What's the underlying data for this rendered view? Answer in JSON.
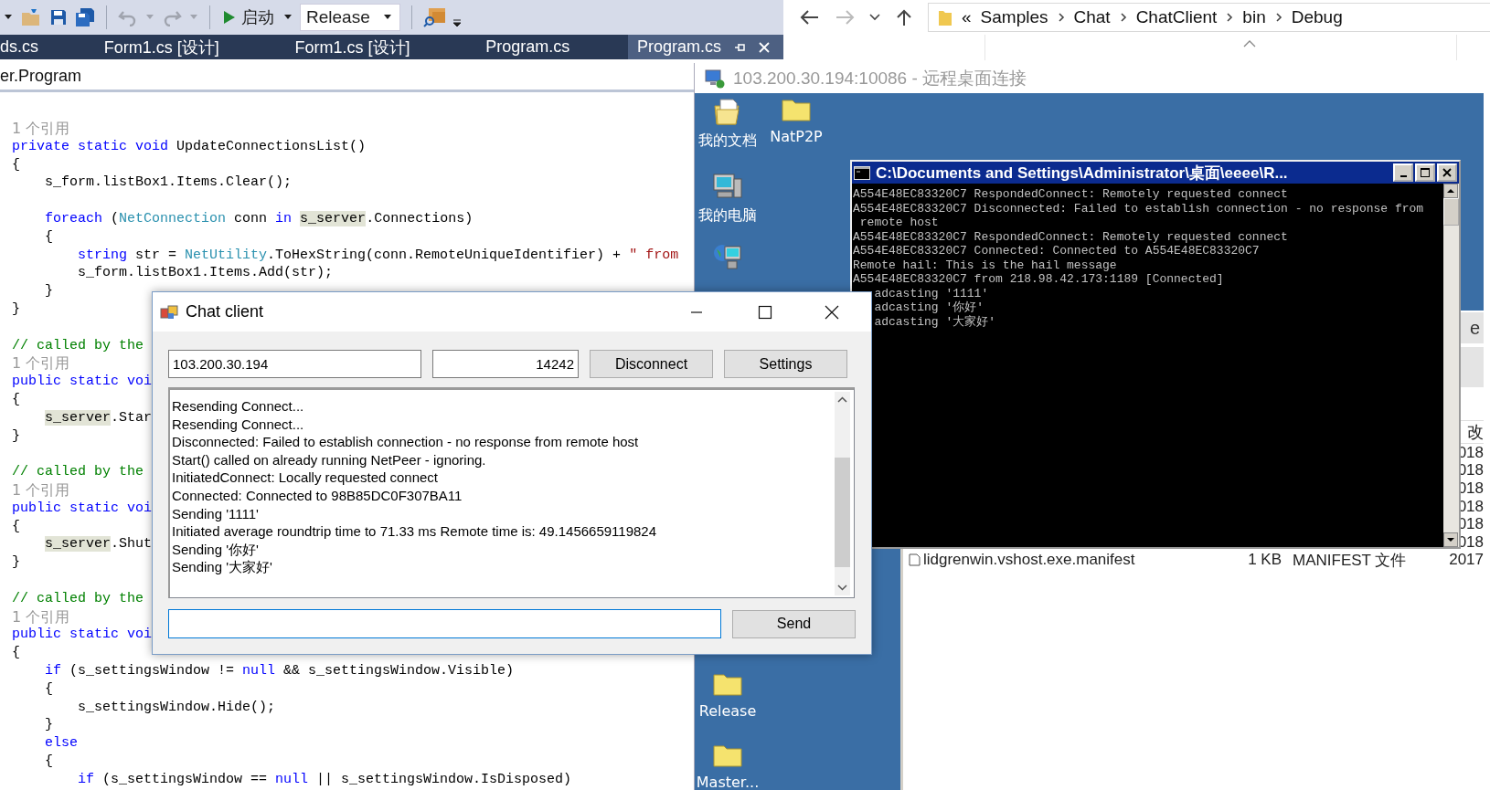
{
  "ide": {
    "toolbar": {
      "run_label": "启动",
      "configuration": "Release"
    },
    "tabs": [
      {
        "label": "ds.cs",
        "selected": false
      },
      {
        "label": "Form1.cs [设计]",
        "selected": false
      },
      {
        "label": "Form1.cs [设计]",
        "selected": false
      },
      {
        "label": "Program.cs",
        "selected": false
      },
      {
        "label": "Program.cs",
        "selected": true
      }
    ],
    "nav": "er.Program",
    "code": [
      {
        "kind": "ref",
        "text": "1 个引用"
      },
      {
        "kind": "code",
        "tokens": [
          {
            "kind": "kw",
            "t": "private static void "
          },
          {
            "kind": "plain",
            "t": "UpdateConnectionsList()"
          }
        ]
      },
      {
        "kind": "code",
        "tokens": [
          {
            "kind": "plain",
            "t": "{"
          }
        ]
      },
      {
        "kind": "code",
        "tokens": [
          {
            "kind": "plain",
            "t": "    s_form.listBox1.Items.Clear();"
          }
        ]
      },
      {
        "kind": "blank"
      },
      {
        "kind": "code",
        "tokens": [
          {
            "kind": "kw",
            "t": "    foreach "
          },
          {
            "kind": "plain",
            "t": "("
          },
          {
            "kind": "type",
            "t": "NetConnection"
          },
          {
            "kind": "plain",
            "t": " conn "
          },
          {
            "kind": "kw",
            "t": "in "
          },
          {
            "kind": "hl",
            "t": "s_server"
          },
          {
            "kind": "plain",
            "t": ".Connections)"
          }
        ]
      },
      {
        "kind": "code",
        "tokens": [
          {
            "kind": "plain",
            "t": "    {"
          }
        ]
      },
      {
        "kind": "code",
        "tokens": [
          {
            "kind": "kw",
            "t": "        string "
          },
          {
            "kind": "plain",
            "t": "str = "
          },
          {
            "kind": "type",
            "t": "NetUtility"
          },
          {
            "kind": "plain",
            "t": ".ToHexString(conn.RemoteUniqueIdentifier) + "
          },
          {
            "kind": "str",
            "t": "\" from"
          }
        ]
      },
      {
        "kind": "code",
        "tokens": [
          {
            "kind": "plain",
            "t": "        s_form.listBox1.Items.Add(str);"
          }
        ]
      },
      {
        "kind": "code",
        "tokens": [
          {
            "kind": "plain",
            "t": "    }"
          }
        ]
      },
      {
        "kind": "code",
        "tokens": [
          {
            "kind": "plain",
            "t": "}"
          }
        ]
      },
      {
        "kind": "blank"
      },
      {
        "kind": "code",
        "tokens": [
          {
            "kind": "comment",
            "t": "// called by the"
          }
        ]
      },
      {
        "kind": "ref",
        "text": "1 个引用"
      },
      {
        "kind": "code",
        "tokens": [
          {
            "kind": "kw",
            "t": "public static voi"
          }
        ]
      },
      {
        "kind": "code",
        "tokens": [
          {
            "kind": "plain",
            "t": "{"
          }
        ]
      },
      {
        "kind": "code",
        "tokens": [
          {
            "kind": "hl",
            "t": "    s_server"
          },
          {
            "kind": "plain",
            "t": ".Star"
          }
        ]
      },
      {
        "kind": "code",
        "tokens": [
          {
            "kind": "plain",
            "t": "}"
          }
        ]
      },
      {
        "kind": "blank"
      },
      {
        "kind": "code",
        "tokens": [
          {
            "kind": "comment",
            "t": "// called by the"
          }
        ]
      },
      {
        "kind": "ref",
        "text": "1 个引用"
      },
      {
        "kind": "code",
        "tokens": [
          {
            "kind": "kw",
            "t": "public static voi"
          }
        ]
      },
      {
        "kind": "code",
        "tokens": [
          {
            "kind": "plain",
            "t": "{"
          }
        ]
      },
      {
        "kind": "code",
        "tokens": [
          {
            "kind": "hl",
            "t": "    s_server"
          },
          {
            "kind": "plain",
            "t": ".Shut"
          }
        ]
      },
      {
        "kind": "code",
        "tokens": [
          {
            "kind": "plain",
            "t": "}"
          }
        ]
      },
      {
        "kind": "blank"
      },
      {
        "kind": "code",
        "tokens": [
          {
            "kind": "comment",
            "t": "// called by the"
          }
        ]
      },
      {
        "kind": "ref",
        "text": "1 个引用"
      },
      {
        "kind": "code",
        "tokens": [
          {
            "kind": "kw",
            "t": "public static voi"
          }
        ]
      },
      {
        "kind": "code",
        "tokens": [
          {
            "kind": "plain",
            "t": "{"
          }
        ]
      },
      {
        "kind": "code",
        "tokens": [
          {
            "kind": "kw",
            "t": "    if "
          },
          {
            "kind": "plain",
            "t": "(s_settingsWindow != "
          },
          {
            "kind": "kw",
            "t": "null"
          },
          {
            "kind": "plain",
            "t": " && s_settingsWindow.Visible)"
          }
        ]
      },
      {
        "kind": "code",
        "tokens": [
          {
            "kind": "plain",
            "t": "    {"
          }
        ]
      },
      {
        "kind": "code",
        "tokens": [
          {
            "kind": "plain",
            "t": "        s_settingsWindow.Hide();"
          }
        ]
      },
      {
        "kind": "code",
        "tokens": [
          {
            "kind": "plain",
            "t": "    }"
          }
        ]
      },
      {
        "kind": "code",
        "tokens": [
          {
            "kind": "kw",
            "t": "    else"
          }
        ]
      },
      {
        "kind": "code",
        "tokens": [
          {
            "kind": "plain",
            "t": "    {"
          }
        ]
      },
      {
        "kind": "code",
        "tokens": [
          {
            "kind": "kw",
            "t": "        if "
          },
          {
            "kind": "plain",
            "t": "(s_settingsWindow == "
          },
          {
            "kind": "kw",
            "t": "null"
          },
          {
            "kind": "plain",
            "t": " || s_settingsWindow.IsDisposed)"
          }
        ]
      }
    ]
  },
  "explorer": {
    "overflow": "«",
    "breadcrumb": [
      "Samples",
      "Chat",
      "ChatClient",
      "bin",
      "Debug"
    ]
  },
  "remote": {
    "title": "103.200.30.194:10086 - 远程桌面连接",
    "desktop_icons": [
      {
        "label": "我的文档",
        "kind": "documents"
      },
      {
        "label": "NatP2P",
        "kind": "folder"
      },
      {
        "label": "我的电脑",
        "kind": "computer"
      },
      {
        "kind": "network"
      },
      {
        "label": "Release",
        "kind": "folder"
      },
      {
        "label": "Master...",
        "kind": "folder"
      }
    ],
    "console": {
      "title": "C:\\Documents and Settings\\Administrator\\桌面\\eeee\\R...",
      "lines": [
        "A554E48EC83320C7 RespondedConnect: Remotely requested connect",
        "A554E48EC83320C7 Disconnected: Failed to establish connection - no response from",
        " remote host",
        "A554E48EC83320C7 RespondedConnect: Remotely requested connect",
        "A554E48EC83320C7 Connected: Connected to A554E48EC83320C7",
        "Remote hail: This is the hail message",
        "A554E48EC83320C7 from 218.98.42.173:1189 [Connected]",
        "   adcasting '1111'",
        "   adcasting '你好'",
        "   adcasting '大家好'"
      ]
    },
    "file_list": {
      "ribbon_text": "e",
      "date_header": "改",
      "rows": [
        {
          "date": "018"
        },
        {
          "date": "018"
        },
        {
          "date": "018"
        },
        {
          "date": "018"
        },
        {
          "date": "018"
        },
        {
          "date": "018"
        },
        {
          "name": "lidgrenwin.vshost.exe.manifest",
          "size": "1 KB",
          "type": "MANIFEST 文件",
          "date": "2017"
        }
      ]
    }
  },
  "chat": {
    "title": "Chat client",
    "host": "103.200.30.194",
    "port": "14242",
    "connect_button": "Disconnect",
    "settings_button": "Settings",
    "send_button": "Send",
    "log": [
      "Resending Connect...",
      "Resending Connect...",
      "Disconnected: Failed to establish connection - no response from remote host",
      "Start() called on already running NetPeer - ignoring.",
      "InitiatedConnect: Locally requested connect",
      "Connected: Connected to 98B85DC0F307BA11",
      "Sending '1111'",
      "Initiated average roundtrip time to 71.33 ms Remote time is: 49.1456659119824",
      "Sending '你好'",
      "Sending '大家好'"
    ]
  }
}
